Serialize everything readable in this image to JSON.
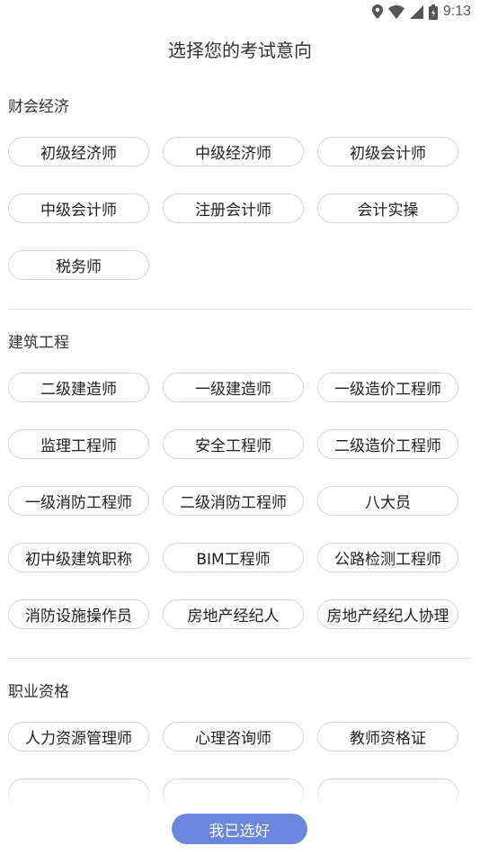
{
  "status": {
    "time": "9:13"
  },
  "title": "选择您的考试意向",
  "sections": [
    {
      "title": "财会经济",
      "items": [
        "初级经济师",
        "中级经济师",
        "初级会计师",
        "中级会计师",
        "注册会计师",
        "会计实操",
        "税务师"
      ]
    },
    {
      "title": "建筑工程",
      "items": [
        "二级建造师",
        "一级建造师",
        "一级造价工程师",
        "监理工程师",
        "安全工程师",
        "二级造价工程师",
        "一级消防工程师",
        "二级消防工程师",
        "八大员",
        "初中级建筑职称",
        "BIM工程师",
        "公路检测工程师",
        "消防设施操作员",
        "房地产经纪人",
        "房地产经纪人协理"
      ]
    },
    {
      "title": "职业资格",
      "items": [
        "人力资源管理师",
        "心理咨询师",
        "教师资格证",
        "",
        "",
        ""
      ]
    }
  ],
  "confirm_label": "我已选好"
}
